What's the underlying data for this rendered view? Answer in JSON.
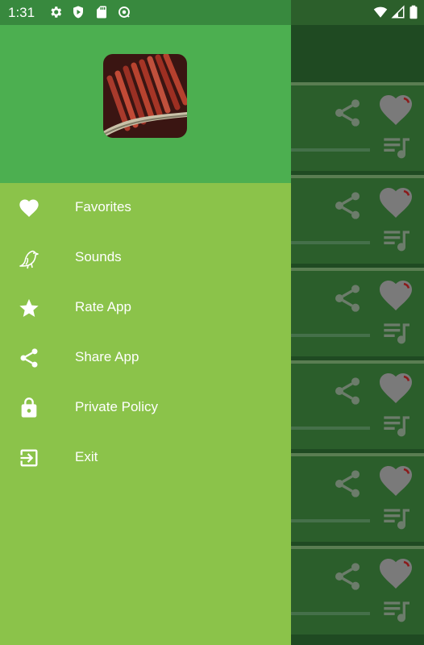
{
  "status_bar": {
    "time": "1:31",
    "left_icons": [
      "settings-icon",
      "shield-play-icon",
      "sd-card-icon",
      "data-saver-icon"
    ],
    "right_icons": [
      "wifi-icon",
      "signal-icon",
      "battery-icon"
    ]
  },
  "drawer": {
    "header_image": "firecracker-logo",
    "menu": [
      {
        "label": "Favorites",
        "icon": "heart-icon"
      },
      {
        "label": "Sounds",
        "icon": "bird-icon"
      },
      {
        "label": "Rate App",
        "icon": "star-icon"
      },
      {
        "label": "Share App",
        "icon": "share-icon"
      },
      {
        "label": "Private Policy",
        "icon": "lock-icon"
      },
      {
        "label": "Exit",
        "icon": "exit-icon"
      }
    ]
  },
  "background_list": {
    "card_count": 6,
    "card_icons": [
      "share-icon",
      "heart-icon",
      "playlist-icon"
    ]
  },
  "colors": {
    "drawer_header": "#4caf50",
    "drawer_body": "#8bc34a",
    "status_bar": "#38893e"
  }
}
